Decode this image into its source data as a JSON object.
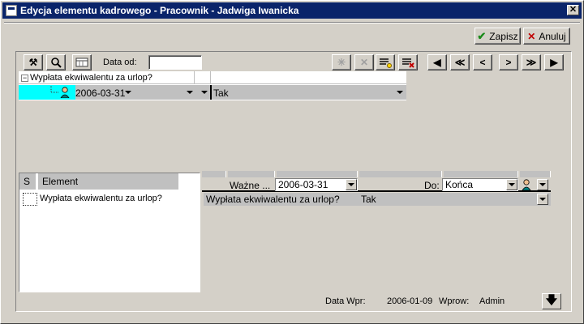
{
  "window": {
    "title": "Edycja elementu kadrowego - Pracownik - Jadwiga Iwanicka",
    "close_glyph": "✕"
  },
  "actions": {
    "save_label": "Zapisz",
    "cancel_label": "Anuluj"
  },
  "toolbar": {
    "date_from_label": "Data od:",
    "date_from_value": "",
    "nav": [
      "◀",
      "≪",
      "<",
      ">",
      "≫",
      "▶"
    ]
  },
  "tree": {
    "root_label": "Wypłata ekwiwalentu za urlop?",
    "row_date": "2006-03-31",
    "row_value": "Tak"
  },
  "left_grid": {
    "col_s": "S",
    "col_element": "Element",
    "rows": [
      {
        "element": "Wypłata ekwiwalentu za urlop?"
      }
    ]
  },
  "right_panel": {
    "valid_label": "Ważne ...",
    "valid_date": "2006-03-31",
    "to_label": "Do:",
    "to_value": "Końca",
    "row_label": "Wypłata ekwiwalentu za urlop?",
    "row_value": "Tak"
  },
  "footer": {
    "entry_date_label": "Data Wpr:",
    "entry_date_value": "2006-01-09",
    "entered_by_label": "Wprow:",
    "entered_by_value": "Admin"
  },
  "colors": {
    "title_bar": "#0a246a",
    "selected_cell": "#00ffff",
    "face": "#d4d0c8"
  }
}
